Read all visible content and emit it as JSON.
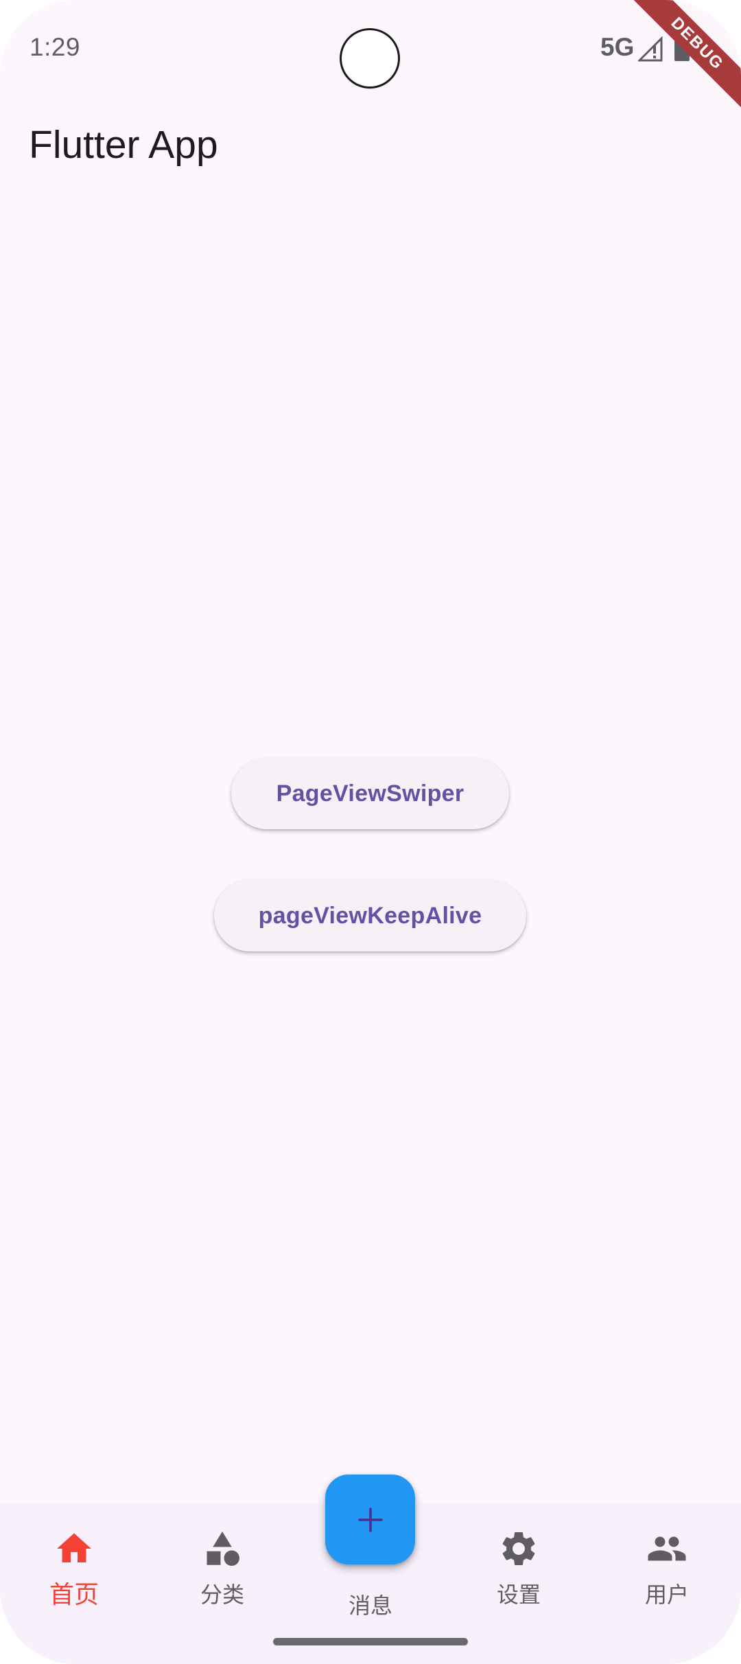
{
  "status_bar": {
    "time": "1:29",
    "network": "5G"
  },
  "debug_banner": "DEBUG",
  "app_bar": {
    "title": "Flutter App"
  },
  "body": {
    "buttons": [
      {
        "label": "PageViewSwiper"
      },
      {
        "label": "pageViewKeepAlive"
      }
    ]
  },
  "bottom_nav": {
    "active_color": "#f44336",
    "inactive_color": "#5f5d63",
    "items": [
      {
        "label": "首页",
        "icon": "home-icon",
        "active": true
      },
      {
        "label": "分类",
        "icon": "category-icon",
        "active": false
      },
      {
        "label": "消息",
        "icon": "message",
        "active": false
      },
      {
        "label": "设置",
        "icon": "gear-icon",
        "active": false
      },
      {
        "label": "用户",
        "icon": "people-icon",
        "active": false
      }
    ]
  },
  "fab": {
    "icon": "plus-icon",
    "color": "#2196f3"
  }
}
